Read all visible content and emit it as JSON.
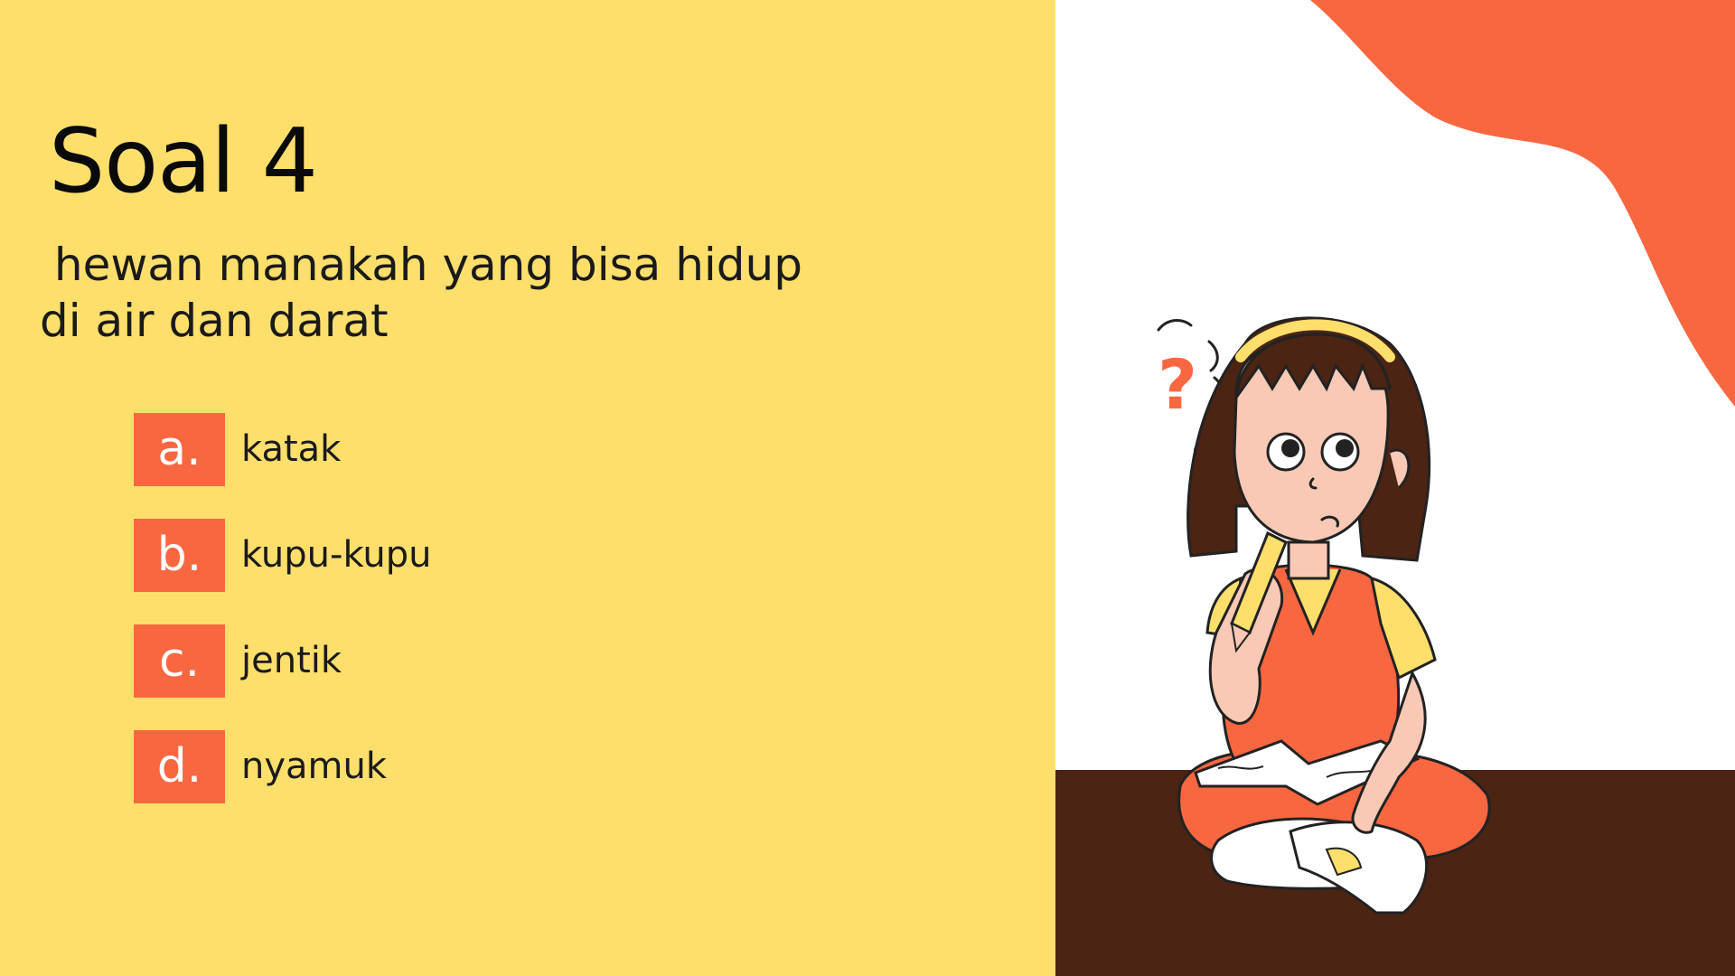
{
  "slide": {
    "title": "Soal 4",
    "question": " hewan manakah yang bisa hidup\ndi air dan darat"
  },
  "options": [
    {
      "letter": "a.",
      "text": "katak"
    },
    {
      "letter": "b.",
      "text": "kupu-kupu"
    },
    {
      "letter": "c.",
      "text": "jentik"
    },
    {
      "letter": "d.",
      "text": "nyamuk"
    }
  ],
  "illustration": {
    "icon": "thinking-girl-illustration",
    "question_mark": "?"
  },
  "colors": {
    "left_background": "#FEDF6C",
    "accent": "#F96741",
    "floor": "#4B2414",
    "white": "#FFFFFF"
  }
}
